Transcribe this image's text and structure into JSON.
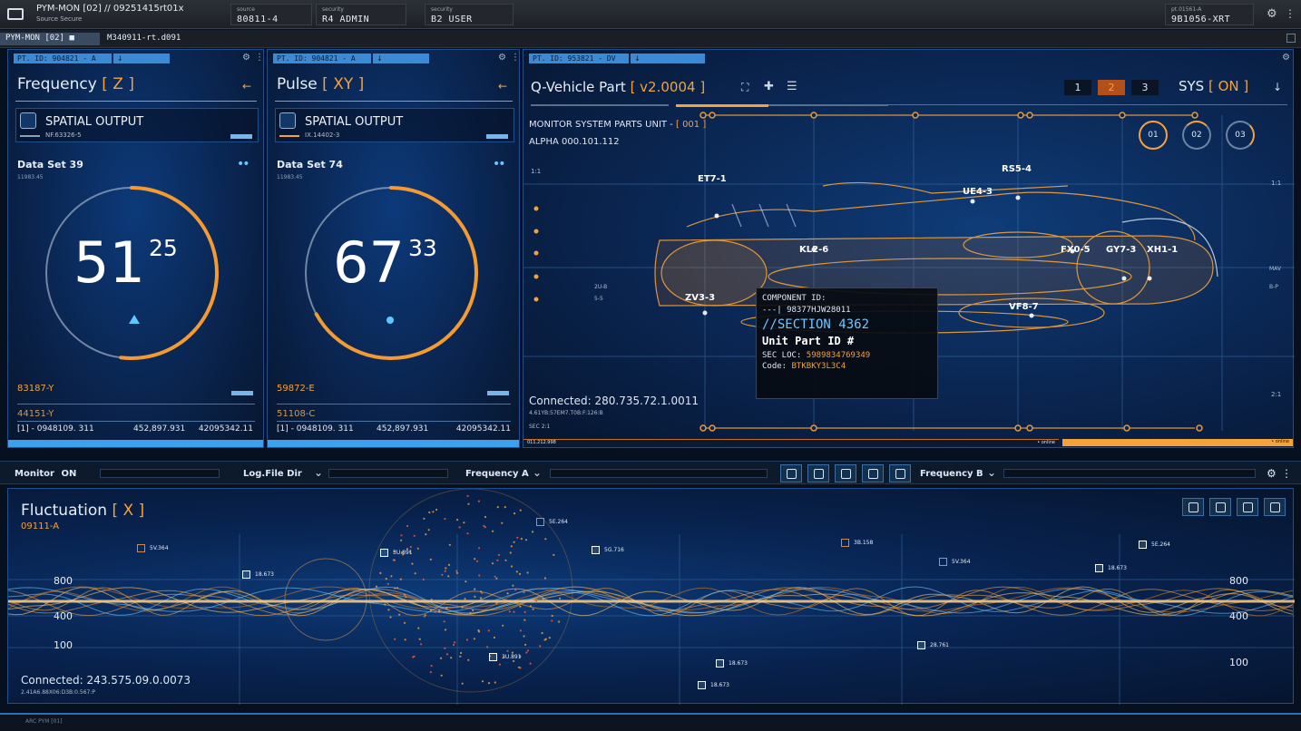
{
  "topbar": {
    "app_title": "PYM-MON [02] // 09251415rt01x",
    "app_subtitle": "Source Secure",
    "source_label": "source",
    "source_value": "80811-4",
    "security1_label": "security",
    "security1_value": "R4 ADMIN",
    "security2_label": "security",
    "security2_value": "B2 USER",
    "right_small": "pt.01561-A",
    "right_value": "9B1056-XRT"
  },
  "subbar": {
    "tab1": "PYM-MON [02] ■",
    "tab2": "M340911-rt.d091"
  },
  "panel1": {
    "pt_id": "PT. ID: 904821 - A",
    "arrow": "↓",
    "title_main": "Frequency ",
    "title_bracket": "[ Z ]",
    "spatial_label": "SPATIAL OUTPUT",
    "spatial_sub": "NF.63326-5",
    "dataset": "Data Set 39",
    "dataset_sub": "11983.45",
    "gauge_big": "51",
    "gauge_small": "25",
    "gauge_fraction": 0.52,
    "code_orange": "83187-Y",
    "code_dim": "44151-Y",
    "row_a": "[1] - 0948109. 311",
    "row_b": "452,897.931",
    "row_c": "42095342.11"
  },
  "panel2": {
    "pt_id": "PT. ID: 904821 - A",
    "arrow": "↓",
    "title_main": "Pulse ",
    "title_bracket": "[ XY ]",
    "spatial_label": "SPATIAL OUTPUT",
    "spatial_sub": "IX.14402-3",
    "dataset": "Data Set 74",
    "dataset_sub": "11983.45",
    "gauge_big": "67",
    "gauge_small": "33",
    "gauge_fraction": 0.67,
    "code_orange": "59872-E",
    "code_dim": "51108-C",
    "row_a": "[1] - 0948109. 311",
    "row_b": "452,897.931",
    "row_c": "42095342.11"
  },
  "vehicle": {
    "pt_id": "PT. ID: 953821 - DV",
    "arrow": "↓",
    "title_main": "Q-Vehicle Part ",
    "title_bracket": "[ v2.0004 ]",
    "seg1": "1",
    "seg2": "2",
    "seg3": "3",
    "sys_main": "SYS ",
    "sys_bracket": "[ ON ]",
    "sys_arrow": "↓",
    "monitor_main": "MONITOR SYSTEM PARTS UNIT - ",
    "monitor_bracket": "[ 001 ]",
    "alpha": "ALPHA 000.101.112",
    "circle1": "01",
    "circle2": "02",
    "circle3": "03",
    "ratio_left": "1:1",
    "ratio_right": "1:1",
    "ratio_right2": "2:1",
    "left_small_1": "2U-B",
    "left_small_2": "5-5",
    "right_small_1": "MAV",
    "right_small_2": "B-P",
    "labels": [
      "ET7-1",
      "RS5-4",
      "UE4-3",
      "KL2-6",
      "FX0-5",
      "GY7-3",
      "XH1-1",
      "ZV3-3",
      "VF8-7"
    ],
    "connected": "Connected: 280.735.72.1.0011",
    "connected_sub": "4.61YB:57EM7.T0B:F:126:B",
    "sec": "SEC 2:1",
    "strip_left": "011.212.998",
    "strip_mid": "• online",
    "strip_right": "• online",
    "tooltip": {
      "line1": "COMPONENT ID:",
      "line2": "---| 98377HJW28011",
      "line3": "//SECTION 4362",
      "line4": "Unit Part ID #",
      "line5_label": "SEC LOC: ",
      "line5_value": "5989834769349",
      "line6_label": "Code: ",
      "line6_value": "BTKBKY3L3C4"
    }
  },
  "controls": {
    "monitor_label": "Monitor",
    "monitor_state": "ON",
    "logfile_label": "Log.File Dir",
    "freq_a_label": "Frequency A",
    "freq_b_label": "Frequency B",
    "chevron": "⌄"
  },
  "fluctuation": {
    "title_main": "Fluctuation ",
    "title_bracket": "[ X ]",
    "subtitle": "09111-A",
    "y_left": [
      "800",
      "400",
      "100"
    ],
    "y_right": [
      "800",
      "400",
      "100"
    ],
    "connected": "Connected: 243.575.09.0.0073",
    "connected_sub": "2.41A6.88X06:D3B:0.567:P",
    "tags": [
      "5E.264",
      "5V.364",
      "3U.891",
      "5G.716",
      "18.673",
      "3B.158",
      "5V.364",
      "5E.264",
      "18.673",
      "3U.891",
      "18.673",
      "28.761",
      "18.673"
    ]
  },
  "footer": {
    "text": "ARC PYM [01]"
  }
}
